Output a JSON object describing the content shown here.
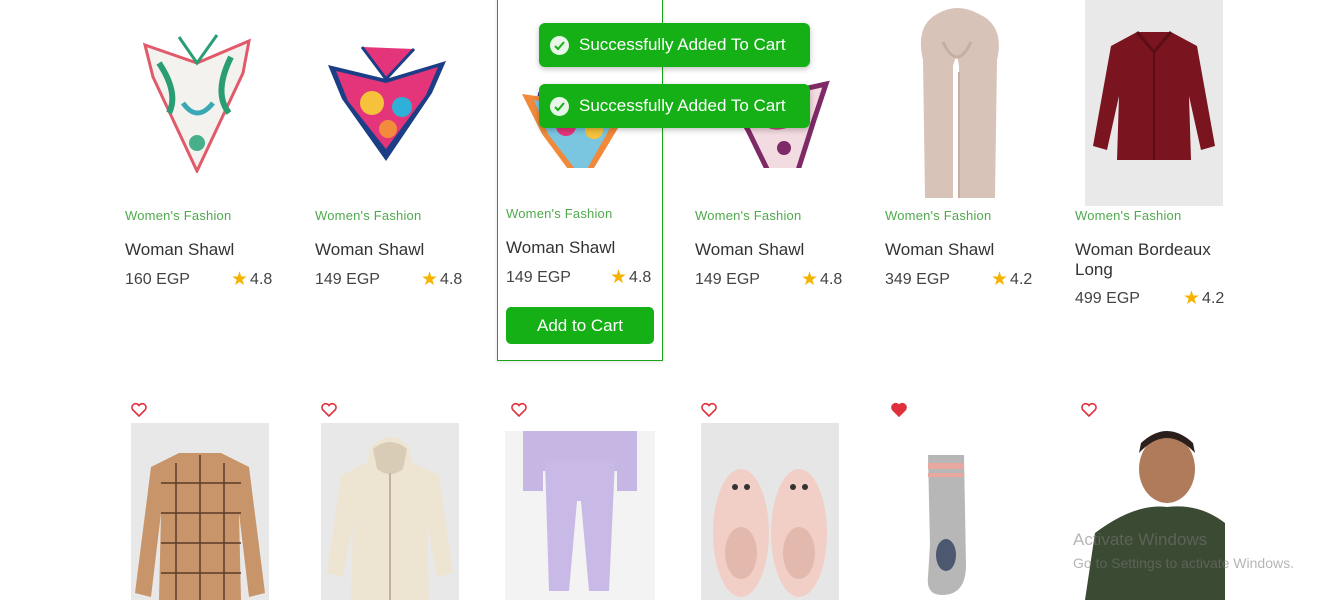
{
  "toasts": [
    {
      "text": "Successfully Added To Cart"
    },
    {
      "text": "Successfully Added To Cart"
    }
  ],
  "row1": [
    {
      "category": "Women's Fashion",
      "title": "Woman Shawl",
      "price": "160 EGP",
      "rating": "4.8",
      "icon": "scarf-floral-icon"
    },
    {
      "category": "Women's Fashion",
      "title": "Woman Shawl",
      "price": "149 EGP",
      "rating": "4.8",
      "icon": "scarf-pink-icon"
    },
    {
      "category": "Women's Fashion",
      "title": "Woman Shawl",
      "price": "149 EGP",
      "rating": "4.8",
      "icon": "scarf-orange-icon"
    },
    {
      "category": "Women's Fashion",
      "title": "Woman Shawl",
      "price": "149 EGP",
      "rating": "4.8",
      "icon": "scarf-purple-icon"
    },
    {
      "category": "Women's Fashion",
      "title": "Woman Shawl",
      "price": "349 EGP",
      "rating": "4.2",
      "icon": "scarf-beige-icon"
    },
    {
      "category": "Women's Fashion",
      "title": "Woman Bordeaux Long",
      "price": "499 EGP",
      "rating": "4.2",
      "icon": "blouse-bordeaux-icon"
    }
  ],
  "add_to_cart_label": "Add to Cart",
  "row2": [
    {
      "icon": "plaid-shirt-icon",
      "wishlisted": false
    },
    {
      "icon": "hoodie-icon",
      "wishlisted": false
    },
    {
      "icon": "joggers-icon",
      "wishlisted": false
    },
    {
      "icon": "slippers-icon",
      "wishlisted": false
    },
    {
      "icon": "sock-icon",
      "wishlisted": true
    },
    {
      "icon": "man-tshirt-icon",
      "wishlisted": false
    }
  ],
  "watermark": {
    "title": "Activate Windows",
    "subtitle": "Go to Settings to activate Windows."
  },
  "colors": {
    "accent": "#15b015",
    "category": "#4fa94d",
    "star": "#f5b301",
    "heart": "#e0303c"
  }
}
